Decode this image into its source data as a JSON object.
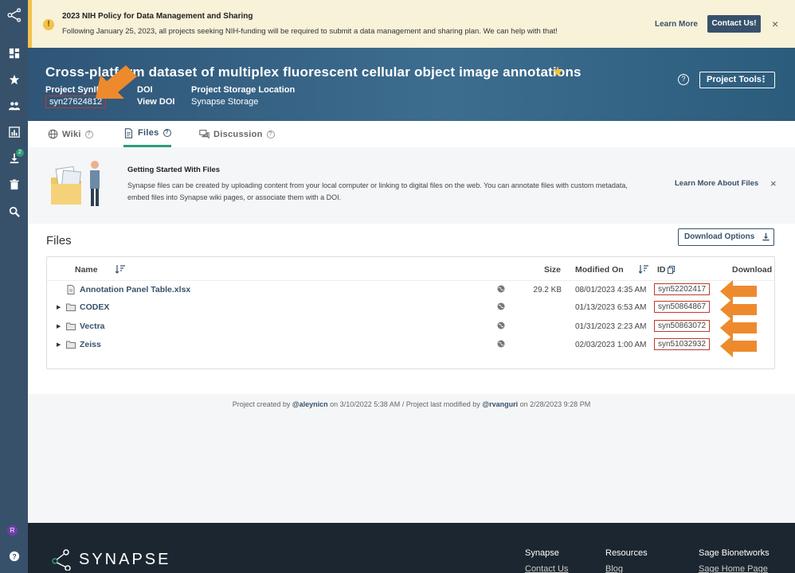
{
  "banner": {
    "title": "2023 NIH Policy for Data Management and Sharing",
    "text": "Following January 25, 2023, all projects seeking NIH-funding will be required to submit a data management and sharing plan. We can help with that!",
    "learn_more": "Learn More",
    "contact": "Contact Us!",
    "close": "×"
  },
  "project": {
    "title": "Cross-platform dataset of multiplex fluorescent cellular object image annotations",
    "synid_label": "Project SynID",
    "synid": "syn27624812",
    "doi_label": "DOI",
    "doi_link": "View DOI",
    "storage_label": "Project Storage Location",
    "storage_value": "Synapse Storage",
    "tools_label": "Project Tools",
    "tools_dots": "⋮",
    "help_glyph": "?",
    "star_glyph": "★"
  },
  "tabs": [
    {
      "label": "Wiki"
    },
    {
      "label": "Files"
    },
    {
      "label": "Discussion"
    }
  ],
  "getting_started": {
    "heading": "Getting Started With Files",
    "text": "Synapse files can be created by uploading content from your local computer or linking to digital files on the web. You can annotate files with custom metadata, embed files into Synapse wiki pages, or associate them with a DOI.",
    "learn_more": "Learn More About Files",
    "close": "×"
  },
  "files": {
    "title": "Files",
    "download_options": "Download Options",
    "columns": {
      "name": "Name",
      "size": "Size",
      "modified": "Modified On",
      "id": "ID",
      "download": "Download"
    },
    "rows": [
      {
        "name": "Annotation Panel Table.xlsx",
        "size": "29.2 KB",
        "modified": "08/01/2023 4:35 AM",
        "id": "syn52202417",
        "type": "file"
      },
      {
        "name": "CODEX",
        "size": "",
        "modified": "01/13/2023 6:53 AM",
        "id": "syn50864867",
        "type": "folder"
      },
      {
        "name": "Vectra",
        "size": "",
        "modified": "01/31/2023 2:23 AM",
        "id": "syn50863072",
        "type": "folder"
      },
      {
        "name": "Zeiss",
        "size": "",
        "modified": "02/03/2023 1:00 AM",
        "id": "syn51032932",
        "type": "folder"
      }
    ]
  },
  "footer_line": {
    "created_prefix": "Project created by",
    "created_user": "@aleynicn",
    "created_date": "on 3/10/2022 5:38 AM  /  Project last modified by",
    "modified_user": "@rvanguri",
    "modified_date": "on 2/28/2023 9:28 PM"
  },
  "rail": {
    "download_badge": "2",
    "avatar_initial": "R",
    "help_glyph": "?"
  },
  "site_footer": {
    "brand": "SYNAPSE",
    "col1_title": "Synapse",
    "col1_link": "Contact Us",
    "col2_title": "Resources",
    "col2_link": "Blog",
    "col3_title": "Sage Bionetworks",
    "col3_link": "Sage Home Page"
  },
  "colors": {
    "primary": "#37516b",
    "accent": "#2e9c7a",
    "warning": "#f3c24d",
    "annotation_arrow": "#ee8a2e",
    "annotation_box": "#c0392b"
  }
}
